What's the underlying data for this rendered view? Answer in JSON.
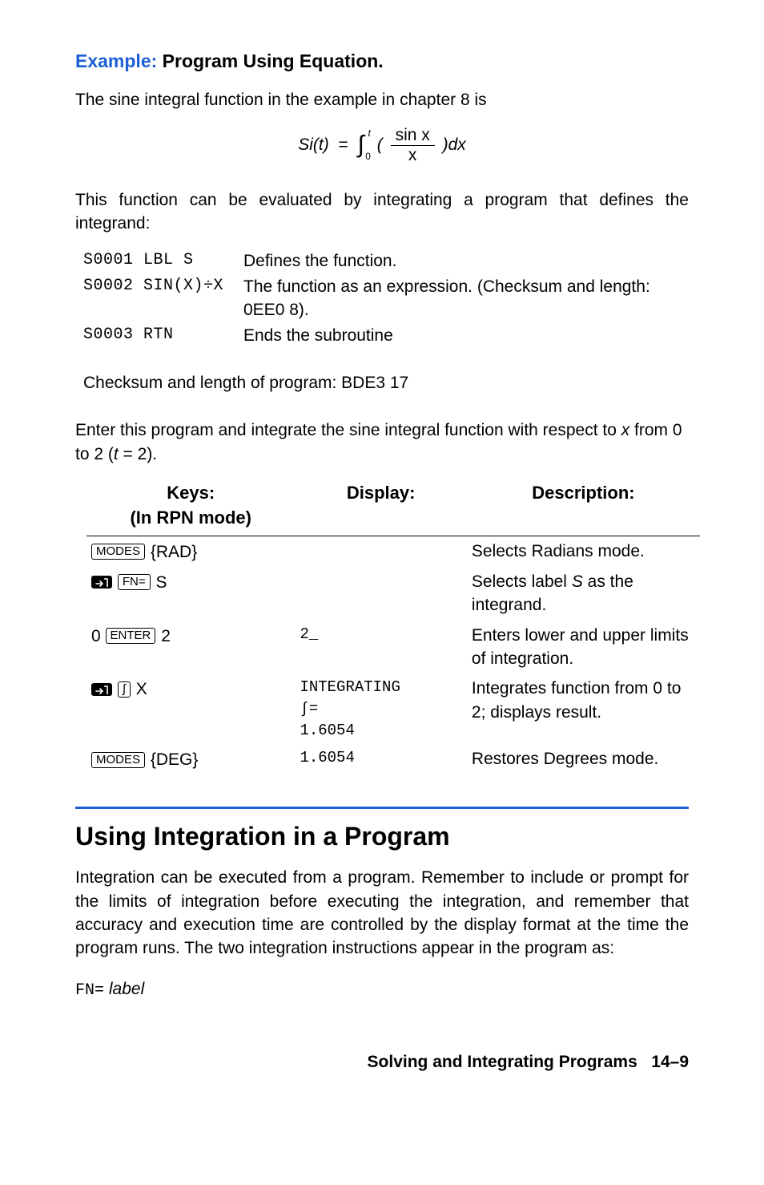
{
  "example": {
    "label": "Example:",
    "title": "Program Using Equation."
  },
  "intro1": "The sine integral function in the example in chapter 8 is",
  "formula": {
    "lhs": "Si(t)",
    "eq": "=",
    "int_upper": "t",
    "int_lower": "0",
    "num": "sin x",
    "den": "x",
    "dx": "dx"
  },
  "intro2": "This function can be evaluated by integrating a program that defines the integrand:",
  "steps": [
    {
      "code": "S0001 LBL S",
      "desc": "Defines the function."
    },
    {
      "code": "S0002 SIN(X)÷X",
      "desc": "The function as an expression. (Checksum and length: 0EE0   8)."
    },
    {
      "code": "S0003 RTN",
      "desc": "Ends the subroutine"
    }
  ],
  "checksum": "Checksum and length of program: BDE3   17",
  "intro3_a": "Enter this program and integrate the sine integral function with respect to ",
  "intro3_var": "x",
  "intro3_b": " from 0 to 2 (",
  "intro3_tvar": "t",
  "intro3_c": " = 2).",
  "table": {
    "head_keys_l1": "Keys:",
    "head_keys_l2": "(In RPN mode)",
    "head_disp": "Display:",
    "head_desc": "Description:",
    "rows": [
      {
        "keys": [
          {
            "type": "key",
            "label": "MODES"
          },
          {
            "type": "text",
            "label": " {RAD}"
          }
        ],
        "disp": "",
        "desc": "Selects Radians mode."
      },
      {
        "keys": [
          {
            "type": "shift"
          },
          {
            "type": "key",
            "label": "FN="
          },
          {
            "type": "text",
            "label": " S"
          }
        ],
        "disp": "",
        "desc_pre": "Selects label ",
        "desc_it": "S",
        "desc_post": " as the integrand."
      },
      {
        "keys": [
          {
            "type": "text",
            "label": "0 "
          },
          {
            "type": "key",
            "label": "ENTER"
          },
          {
            "type": "text",
            "label": " 2"
          }
        ],
        "disp": "2_",
        "desc": "Enters lower and upper limits of integration."
      },
      {
        "keys": [
          {
            "type": "shift"
          },
          {
            "type": "key",
            "label": "∫"
          },
          {
            "type": "text",
            "label": " X"
          }
        ],
        "disp": "INTEGRATING\n∫=\n1.6054",
        "desc": "Integrates function from 0 to 2; displays result."
      },
      {
        "keys": [
          {
            "type": "key",
            "label": "MODES"
          },
          {
            "type": "text",
            "label": " {DEG}"
          }
        ],
        "disp": "1.6054",
        "desc": "Restores Degrees mode."
      }
    ]
  },
  "section_title": "Using Integration in a Program",
  "section_para": "Integration can be executed from a program. Remember to include or prompt for the limits of integration before executing the integration, and remember that accuracy and execution time are controlled by the display format at the time the program runs. The two integration instructions appear in the program as:",
  "fn_code": "FN=",
  "fn_label": "label",
  "footer_text": "Solving and Integrating Programs",
  "footer_page": "14–9"
}
